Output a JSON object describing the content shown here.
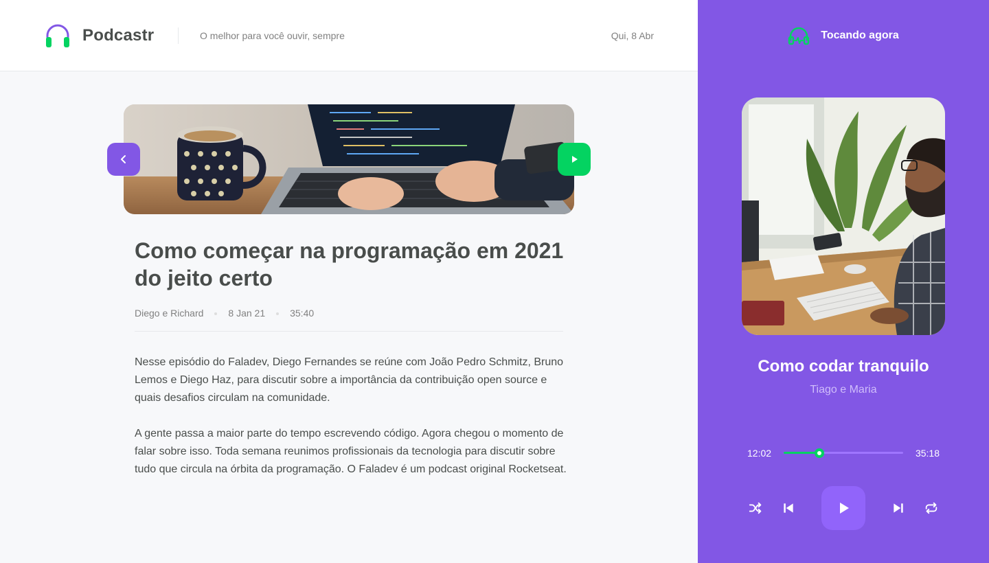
{
  "header": {
    "brand": "Podcastr",
    "tagline": "O melhor para você ouvir, sempre",
    "date": "Qui, 8 Abr"
  },
  "episode": {
    "title": "Como começar na programação em 2021 do jeito certo",
    "members": "Diego e Richard",
    "published_at": "8 Jan 21",
    "duration": "35:40",
    "description": [
      "Nesse episódio do Faladev, Diego Fernandes se reúne com João Pedro Schmitz, Bruno Lemos e Diego Haz, para discutir sobre a importância da contribuição open source e quais desafios circulam na comunidade.",
      "A gente passa a maior parte do tempo escrevendo código. Agora chegou o momento de falar sobre isso. Toda semana reunimos profissionais da tecnologia para discutir sobre tudo que circula na órbita da programação. O Faladev é um podcast original Rocketseat."
    ]
  },
  "player": {
    "heading": "Tocando agora",
    "track_title": "Como codar tranquilo",
    "track_artists": "Tiago e Maria",
    "current_time": "12:02",
    "total_time": "35:18",
    "progress_fraction": 0.3
  },
  "icons": {
    "logo": "headphones-logo-icon",
    "back": "chevron-left-icon",
    "play_episode": "play-icon",
    "now_playing": "headphones-icon",
    "shuffle": "shuffle-icon",
    "previous": "skip-previous-icon",
    "play": "play-icon",
    "next": "skip-next-icon",
    "repeat": "repeat-icon"
  },
  "colors": {
    "purple": "#8257e5",
    "green": "#04d361",
    "text": "#494d4b",
    "muted": "#808080"
  }
}
